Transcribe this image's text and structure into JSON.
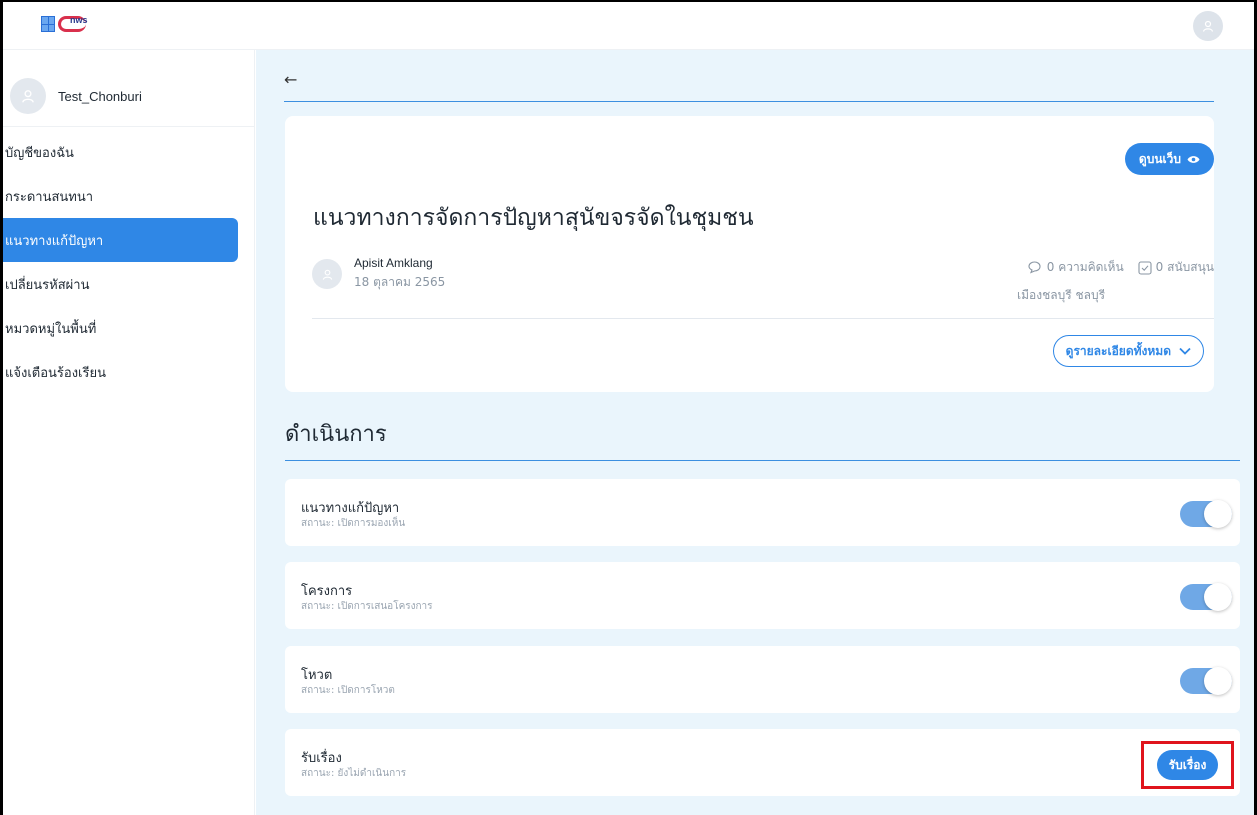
{
  "header": {
    "logo_text": "nws"
  },
  "sidebar": {
    "user_name": "Test_Chonburi",
    "items": [
      {
        "label": "บัญชีของฉัน"
      },
      {
        "label": "กระดานสนทนา"
      },
      {
        "label": "แนวทางแก้ปัญหา"
      },
      {
        "label": "เปลี่ยนรหัสผ่าน"
      },
      {
        "label": "หมวดหมู่ในพื้นที่"
      },
      {
        "label": "แจ้งเตือนร้องเรียน"
      }
    ]
  },
  "post": {
    "view_web_label": "ดูบนเว็บ",
    "title": "แนวทางการจัดการปัญหาสุนัขจรจัดในชุมชน",
    "author": "Apisit Amklang",
    "date": "18 ตุลาคม 2565",
    "comments": "0 ความคิดเห็น",
    "supports": "0 สนับสนุน",
    "location": "เมืองชลบุรี ชลบุรี",
    "detail_label": "ดูรายละเอียดทั้งหมด"
  },
  "actions": {
    "section_title": "ดำเนินการ",
    "items": [
      {
        "name": "แนวทางแก้ปัญหา",
        "status": "สถานะ: เปิดการมองเห็น"
      },
      {
        "name": "โครงการ",
        "status": "สถานะ: เปิดการเสนอโครงการ"
      },
      {
        "name": "โหวต",
        "status": "สถานะ: เปิดการโหวต"
      },
      {
        "name": "รับเรื่อง",
        "status": "สถานะ: ยังไม่ดำเนินการ",
        "button_label": "รับเรื่อง"
      }
    ]
  },
  "colors": {
    "accent": "#2f87e6",
    "highlight": "#e0141c",
    "main_bg": "#eaf5fc"
  }
}
